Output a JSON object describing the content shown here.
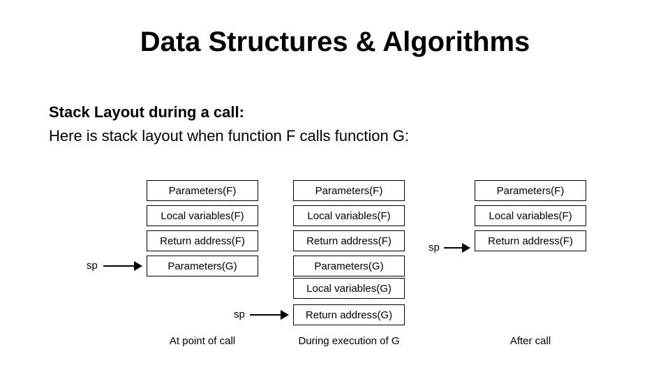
{
  "title": "Data Structures & Algorithms",
  "subtitle": "Stack Layout during a call:",
  "desc": "Here is stack layout when function F calls function G:",
  "rows": {
    "paramsF": "Parameters(F)",
    "localsF": "Local variables(F)",
    "retF": "Return address(F)",
    "paramsG": "Parameters(G)",
    "localsG": "Local variables(G)",
    "retG": "Return address(G)"
  },
  "captions": {
    "col1": "At point of call",
    "col2": "During execution of G",
    "col3": "After call"
  },
  "sp": "sp"
}
